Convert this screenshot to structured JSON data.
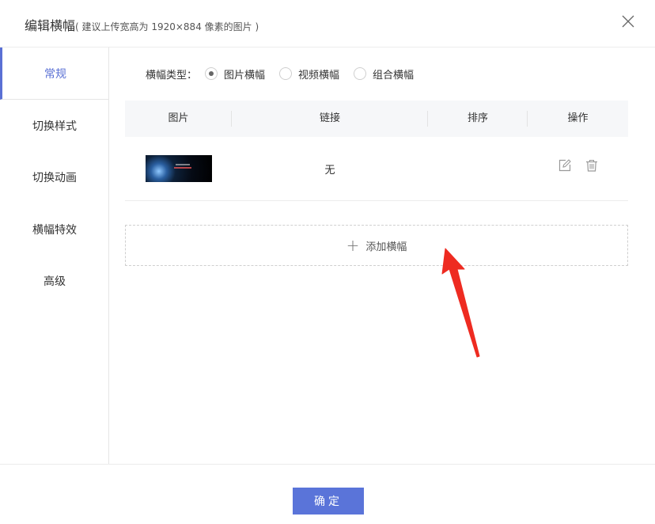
{
  "dialog": {
    "title": "编辑横幅",
    "hint": "( 建议上传宽高为 1920×884 像素的图片 )"
  },
  "sidebar": {
    "items": [
      {
        "label": "常规"
      },
      {
        "label": "切换样式"
      },
      {
        "label": "切换动画"
      },
      {
        "label": "横幅特效"
      },
      {
        "label": "高级"
      }
    ],
    "active_index": 0
  },
  "banner_type": {
    "label": "横幅类型：",
    "options": [
      {
        "label": "图片横幅"
      },
      {
        "label": "视频横幅"
      },
      {
        "label": "组合横幅"
      }
    ],
    "selected": "图片横幅"
  },
  "table": {
    "headers": [
      "图片",
      "链接",
      "排序",
      "操作"
    ],
    "rows": [
      {
        "link": "无",
        "sort": ""
      }
    ]
  },
  "add_banner": {
    "plus": "+",
    "label": "添加横幅"
  },
  "footer": {
    "ok_label": "确定"
  },
  "colors": {
    "accent": "#5a74d9",
    "arrow": "#ee2b21"
  },
  "icons": {
    "close": "close-icon",
    "edit": "edit-icon",
    "delete": "trash-icon"
  }
}
